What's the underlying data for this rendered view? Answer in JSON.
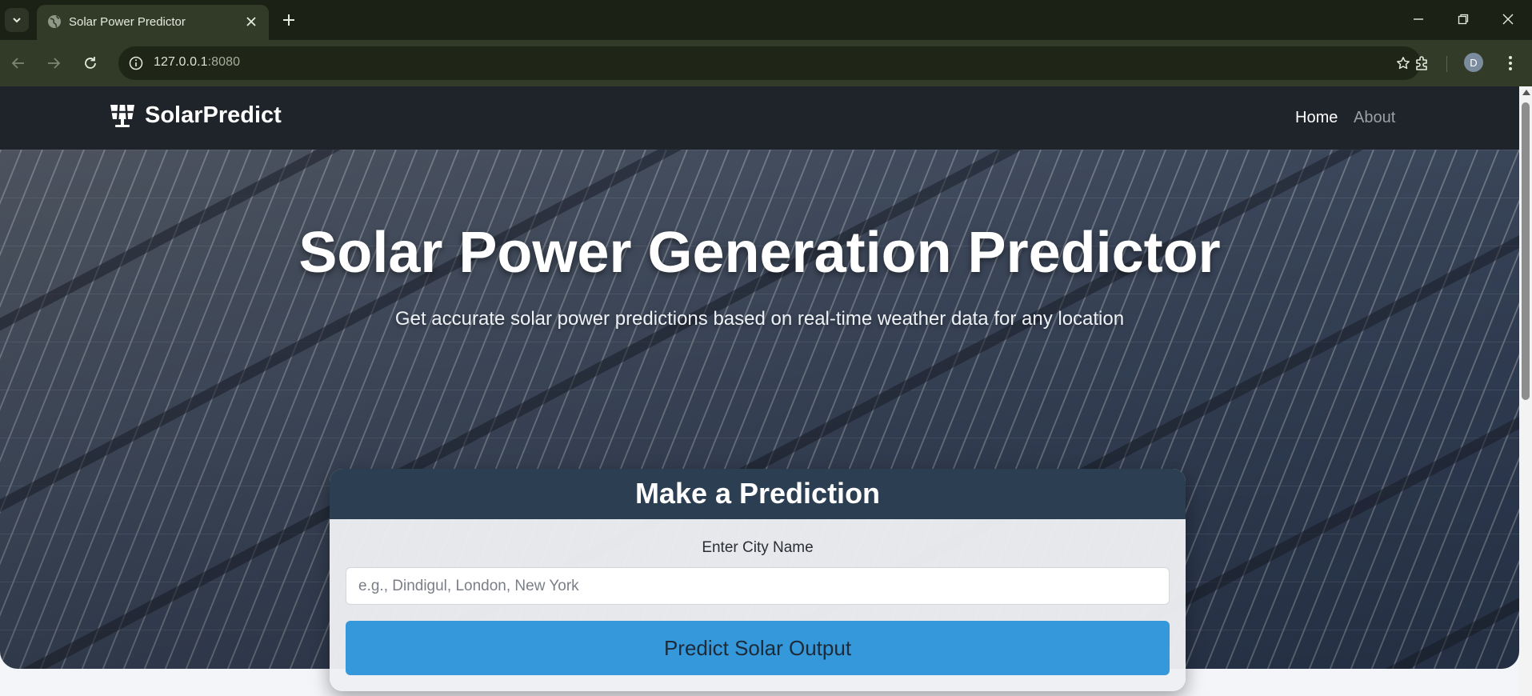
{
  "browser": {
    "tab_title": "Solar Power Predictor",
    "url_host": "127.0.0.1",
    "url_port": ":8080",
    "profile_initial": "D"
  },
  "navbar": {
    "brand": "SolarPredict",
    "links": [
      {
        "label": "Home"
      },
      {
        "label": "About"
      }
    ]
  },
  "hero": {
    "title": "Solar Power Generation Predictor",
    "subtitle": "Get accurate solar power predictions based on real-time weather data for any location"
  },
  "form": {
    "heading": "Make a Prediction",
    "city_label": "Enter City Name",
    "city_placeholder": "e.g., Dindigul, London, New York",
    "city_value": "",
    "submit_label": "Predict Solar Output"
  },
  "colors": {
    "navbar_bg": "#1f232a",
    "card_header_bg": "#2c3e52",
    "button_bg": "#3498db",
    "browser_chrome": "#323a28"
  }
}
